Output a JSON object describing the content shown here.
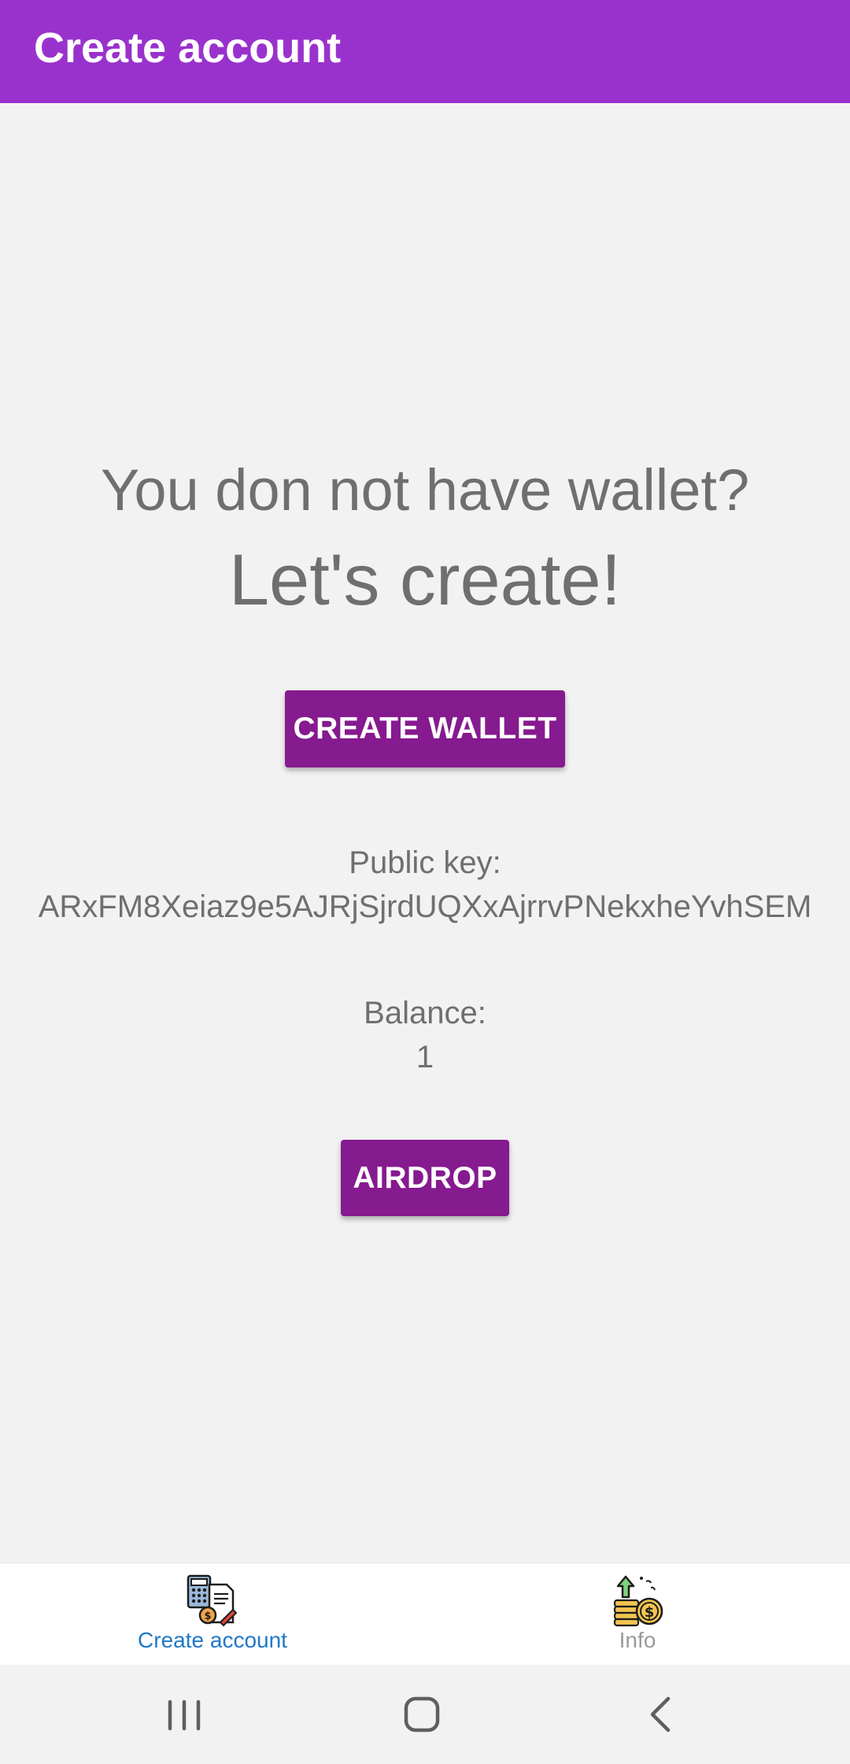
{
  "app_bar": {
    "title": "Create account",
    "color": "#9932cc"
  },
  "main": {
    "prompt": "You don not have wallet?",
    "call_to_action": "Let's create!",
    "create_wallet_label": "CREATE WALLET",
    "public_key_label": "Public key:",
    "public_key_value": "ARxFM8Xeiaz9e5AJRjSjrdUQXxAjrrvPNekxheYvhSEM",
    "balance_label": "Balance:",
    "balance_value": "1",
    "airdrop_label": "AIRDROP",
    "button_color": "#861a8f",
    "text_color": "#6f6f6f"
  },
  "bottom_nav": {
    "items": [
      {
        "label": "Create account",
        "icon": "create-account-icon",
        "active": true,
        "color": "#1f78c8"
      },
      {
        "label": "Info",
        "icon": "info-coins-icon",
        "active": false,
        "color": "#9a9a9a"
      }
    ]
  },
  "system_nav": {
    "buttons": [
      "recent-apps-icon",
      "home-icon",
      "back-icon"
    ]
  }
}
